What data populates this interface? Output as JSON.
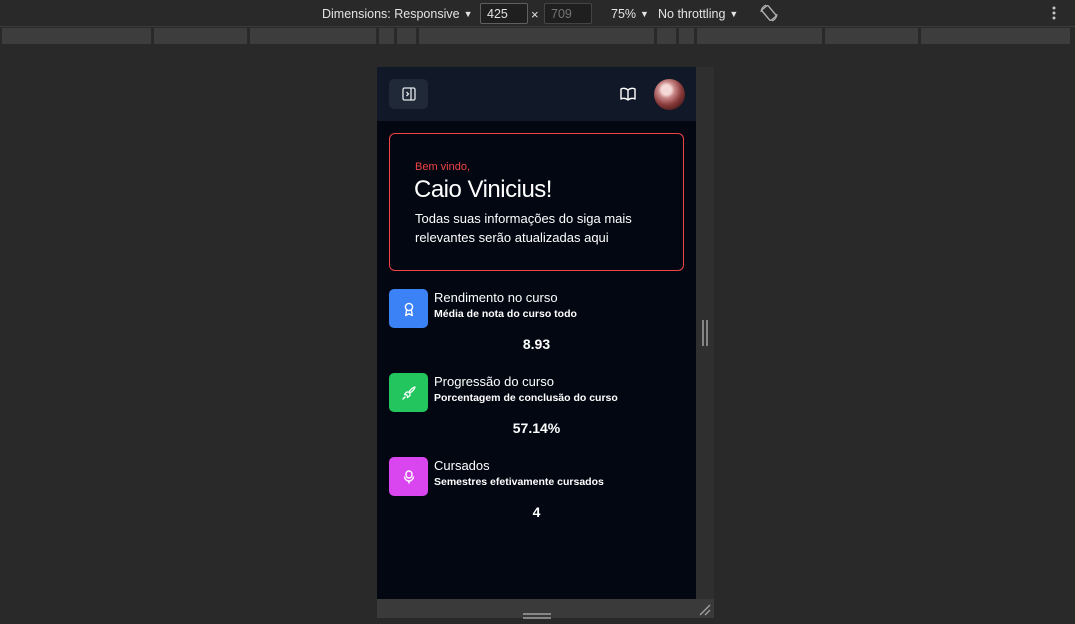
{
  "devtools": {
    "dimensions_label": "Dimensions: Responsive",
    "width_value": "425",
    "height_placeholder": "709",
    "times_symbol": "×",
    "zoom": "75%",
    "throttling": "No throttling"
  },
  "app": {
    "welcome": {
      "greeting": "Bem vindo,",
      "name": "Caio Vinicius!",
      "description": "Todas suas informações do siga mais relevantes serão atualizadas aqui"
    },
    "stats": [
      {
        "title": "Rendimento no curso",
        "subtitle": "Média de nota do curso todo",
        "value": "8.93",
        "icon": "award-icon",
        "color": "#3b82f6"
      },
      {
        "title": "Progressão do curso",
        "subtitle": "Porcentagem de conclusão do curso",
        "value": "57.14%",
        "icon": "rocket-icon",
        "color": "#22c55e"
      },
      {
        "title": "Cursados",
        "subtitle": "Semestres efetivamente cursados",
        "value": "4",
        "icon": "microphone-icon",
        "color": "#d946ef"
      }
    ]
  },
  "colors": {
    "accent_red": "#ef4444",
    "app_background": "#030712",
    "header_background": "#111827"
  }
}
